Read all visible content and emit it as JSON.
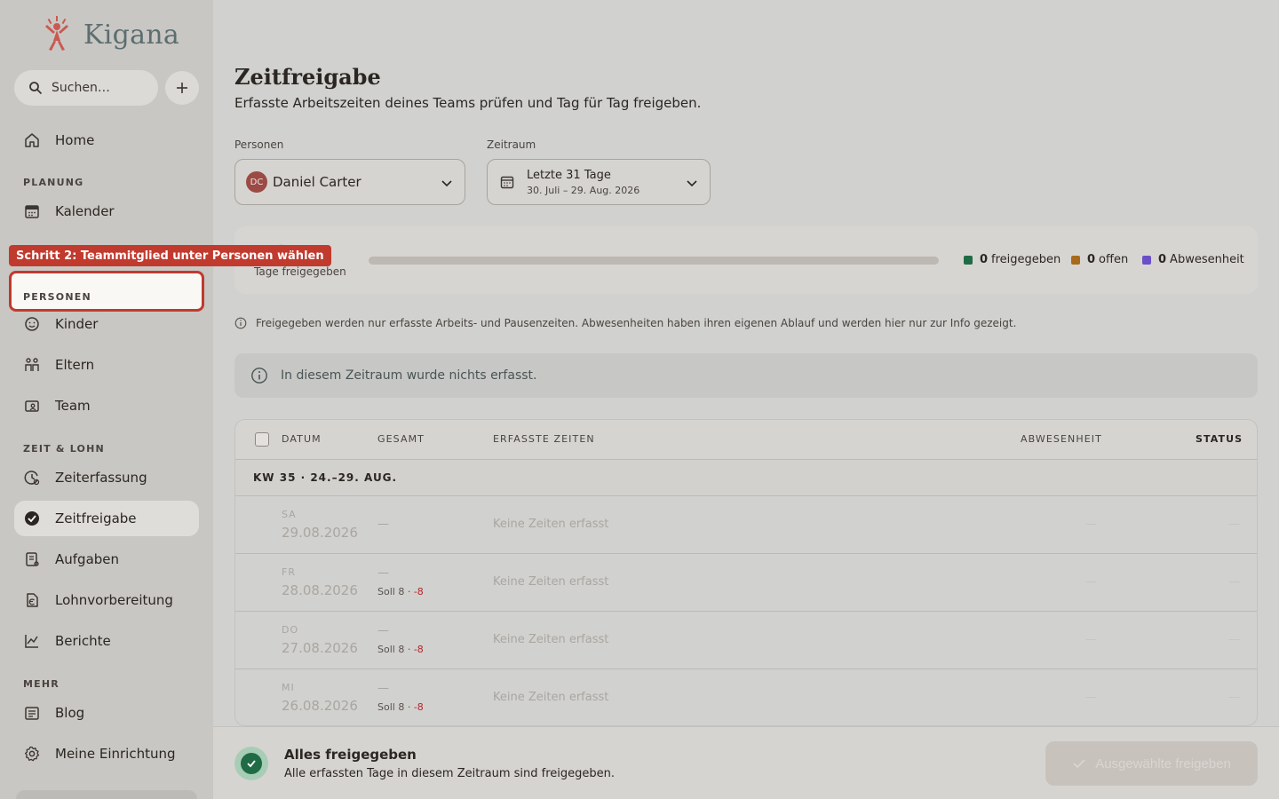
{
  "brand": {
    "name": "Kigana",
    "logo_color": "#c85a52"
  },
  "sidebar": {
    "search_placeholder": "Suchen…",
    "home": "Home",
    "sections": {
      "planung": "PLANUNG",
      "personen": "PERSONEN",
      "zeit_lohn": "ZEIT & LOHN",
      "mehr": "MEHR"
    },
    "items": {
      "kalender": "Kalender",
      "kinder": "Kinder",
      "eltern": "Eltern",
      "team": "Team",
      "zeiterfassung": "Zeiterfassung",
      "zeitfreigabe": "Zeitfreigabe",
      "aufgaben": "Aufgaben",
      "lohnvorbereitung": "Lohnvorbereitung",
      "berichte": "Berichte",
      "blog": "Blog",
      "meine_einrichtung": "Meine Einrichtung"
    },
    "active": "Zeitfreigabe"
  },
  "tutorial": {
    "tooltip": "Schritt 2: Teammitglied unter Personen wählen",
    "accent": "#c13a2e"
  },
  "page": {
    "title": "Zeitfreigabe",
    "subtitle": "Erfasste Arbeitszeiten deines Teams prüfen und Tag für Tag freigeben."
  },
  "filters": {
    "persons_label": "Personen",
    "person_initials": "DC",
    "person_name": "Daniel Carter",
    "range_label": "Zeitraum",
    "range_main": "Letzte 31 Tage",
    "range_sub": "30. Juli – 29. Aug. 2026"
  },
  "summary": {
    "big_value": "0",
    "label": "Tage freigegeben",
    "progress_fraction": 0,
    "legend": [
      {
        "count": "0",
        "label": "freigegeben",
        "color": "#1f6b45"
      },
      {
        "count": "0",
        "label": "offen",
        "color": "#a86a1c"
      },
      {
        "count": "0",
        "label": "Abwesenheit",
        "color": "#6a4fc9"
      }
    ]
  },
  "info_note": "Freigegeben werden nur erfasste Arbeits- und Pausenzeiten. Abwesenheiten haben ihren eigenen Ablauf und werden hier nur zur Info gezeigt.",
  "empty_message": "In diesem Zeitraum wurde nichts erfasst.",
  "table": {
    "headers": {
      "datum": "DATUM",
      "gesamt": "GESAMT",
      "erfasste_zeiten": "ERFASSTE ZEITEN",
      "abwesenheit": "ABWESENHEIT",
      "status": "STATUS"
    },
    "week": "KW 35 · 24.–29. AUG.",
    "rows": [
      {
        "dow": "SA",
        "date": "29.08.2026",
        "total": "—",
        "soll": "",
        "diff": "",
        "times": "Keine Zeiten erfasst",
        "abwesenheit": "—",
        "status": "—"
      },
      {
        "dow": "FR",
        "date": "28.08.2026",
        "total": "—",
        "soll": "Soll 8 · ",
        "diff": "-8",
        "times": "Keine Zeiten erfasst",
        "abwesenheit": "—",
        "status": "—"
      },
      {
        "dow": "DO",
        "date": "27.08.2026",
        "total": "—",
        "soll": "Soll 8 · ",
        "diff": "-8",
        "times": "Keine Zeiten erfasst",
        "abwesenheit": "—",
        "status": "—"
      },
      {
        "dow": "MI",
        "date": "26.08.2026",
        "total": "—",
        "soll": "Soll 8 · ",
        "diff": "-8",
        "times": "Keine Zeiten erfasst",
        "abwesenheit": "—",
        "status": "—"
      }
    ]
  },
  "footer": {
    "title": "Alles freigegeben",
    "subtitle": "Alle erfassten Tage in diesem Zeitraum sind freigegeben.",
    "button": "Ausgewählte freigeben"
  }
}
